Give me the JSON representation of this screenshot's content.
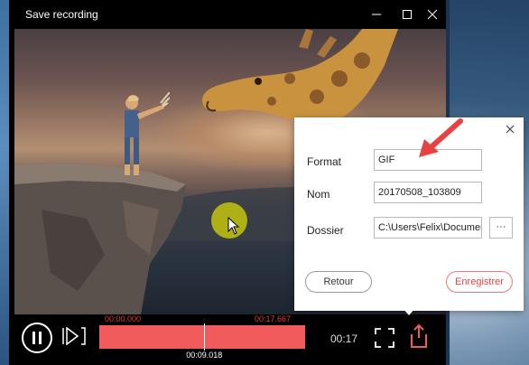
{
  "window": {
    "title": "Save recording"
  },
  "player": {
    "trim_start": "00:00.000",
    "trim_end": "00:17.667",
    "current_time": "00:09.018",
    "duration": "00:17",
    "progress": 0.51
  },
  "dialog": {
    "format_label": "Format",
    "format_value": "GIF",
    "name_label": "Nom",
    "name_value": "20170508_103809",
    "folder_label": "Dossier",
    "folder_value": "C:\\Users\\Felix\\Documents",
    "browse_label": "···",
    "back_label": "Retour",
    "save_label": "Enregistrer"
  },
  "colors": {
    "accent": "#f25b5b",
    "annotation_arrow": "#e84141"
  }
}
